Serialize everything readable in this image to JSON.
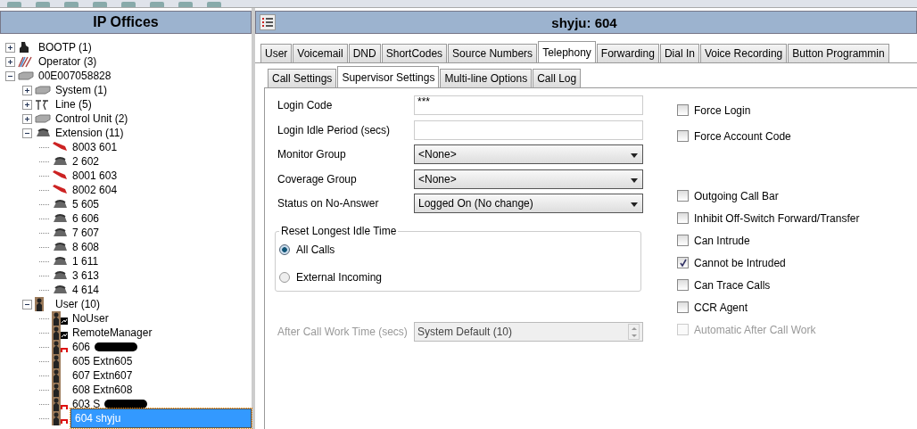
{
  "tree_panel": {
    "title": "IP Offices",
    "items": [
      {
        "label": "BOOTP (1)",
        "kind": "bootp",
        "expanded": false
      },
      {
        "label": "Operator (3)",
        "kind": "operator",
        "expanded": false
      },
      {
        "label": "00E007058828",
        "kind": "unit",
        "expanded": true,
        "children": [
          {
            "label": "System (1)",
            "kind": "unit",
            "expanded": false
          },
          {
            "label": "Line (5)",
            "kind": "line",
            "expanded": false
          },
          {
            "label": "Control Unit (2)",
            "kind": "unit",
            "expanded": false
          },
          {
            "label": "Extension (11)",
            "kind": "phone",
            "expanded": true,
            "children": [
              {
                "label": "8003 601",
                "kind": "cable",
                "selected": false
              },
              {
                "label": "2 602",
                "kind": "phone",
                "selected": false
              },
              {
                "label": "8001 603",
                "kind": "cable",
                "selected": false
              },
              {
                "label": "8002 604",
                "kind": "cable",
                "selected": false
              },
              {
                "label": "5 605",
                "kind": "phone",
                "selected": false
              },
              {
                "label": "6 606",
                "kind": "phone",
                "selected": false
              },
              {
                "label": "7 607",
                "kind": "phone",
                "selected": false
              },
              {
                "label": "8 608",
                "kind": "phone",
                "selected": false
              },
              {
                "label": "1 611",
                "kind": "phone",
                "selected": false
              },
              {
                "label": "3 613",
                "kind": "phone",
                "selected": false
              },
              {
                "label": "4 614",
                "kind": "phone",
                "selected": false
              }
            ]
          },
          {
            "label": "User (10)",
            "kind": "user",
            "expanded": true,
            "children": [
              {
                "label": "NoUser",
                "kind": "user-special",
                "selected": false
              },
              {
                "label": "RemoteManager",
                "kind": "user-special",
                "selected": false
              },
              {
                "label": "606",
                "kind": "user-linked",
                "redacted": true,
                "selected": false
              },
              {
                "label": "605 Extn605",
                "kind": "user",
                "selected": false
              },
              {
                "label": "607 Extn607",
                "kind": "user",
                "selected": false
              },
              {
                "label": "608 Extn608",
                "kind": "user",
                "selected": false
              },
              {
                "label": "603 S",
                "kind": "user-linked",
                "redacted": true,
                "selected": false
              },
              {
                "label": "604 shyju",
                "kind": "user-linked",
                "selected": true
              }
            ]
          }
        ]
      }
    ]
  },
  "detail": {
    "title": "shyju: 604",
    "tabs": [
      {
        "label": "User",
        "selected": false
      },
      {
        "label": "Voicemail",
        "selected": false
      },
      {
        "label": "DND",
        "selected": false
      },
      {
        "label": "ShortCodes",
        "selected": false
      },
      {
        "label": "Source Numbers",
        "selected": false
      },
      {
        "label": "Telephony",
        "selected": true
      },
      {
        "label": "Forwarding",
        "selected": false
      },
      {
        "label": "Dial In",
        "selected": false
      },
      {
        "label": "Voice Recording",
        "selected": false
      },
      {
        "label": "Button Programmin",
        "selected": false
      }
    ],
    "subtabs": [
      {
        "label": "Call Settings",
        "selected": false
      },
      {
        "label": "Supervisor Settings",
        "selected": true
      },
      {
        "label": "Multi-line Options",
        "selected": false
      },
      {
        "label": "Call Log",
        "selected": false
      }
    ],
    "fields": [
      {
        "label": "Login Code",
        "kind": "text",
        "value": "***"
      },
      {
        "label": "Login Idle Period (secs)",
        "kind": "text"
      },
      {
        "label": "Monitor Group",
        "kind": "select",
        "value": "<None>"
      },
      {
        "label": "Coverage Group",
        "kind": "select",
        "value": "<None>"
      },
      {
        "label": "Status on No-Answer",
        "kind": "select",
        "value": "Logged On (No change)"
      }
    ],
    "reset_group": {
      "title": "Reset Longest Idle Time",
      "options": [
        {
          "label": "All Calls",
          "selected": true
        },
        {
          "label": "External Incoming",
          "selected": false
        }
      ]
    },
    "after_call": {
      "label": "After Call Work Time (secs)",
      "value": "System Default (10)",
      "disabled": true
    },
    "login_checkboxes": [
      {
        "label": "Force Login",
        "checked": false,
        "disabled": false
      },
      {
        "label": "Force Account Code",
        "checked": false,
        "disabled": false
      }
    ],
    "call_checkboxes": [
      {
        "label": "Outgoing Call Bar",
        "checked": false,
        "disabled": false
      },
      {
        "label": "Inhibit Off-Switch Forward/Transfer",
        "checked": false,
        "disabled": false
      },
      {
        "label": "Can Intrude",
        "checked": false,
        "disabled": false
      },
      {
        "label": "Cannot be Intruded",
        "checked": true,
        "disabled": false
      },
      {
        "label": "Can Trace Calls",
        "checked": false,
        "disabled": false
      },
      {
        "label": "CCR Agent",
        "checked": false,
        "disabled": false
      },
      {
        "label": "Automatic After Call Work",
        "checked": false,
        "disabled": true
      }
    ]
  }
}
